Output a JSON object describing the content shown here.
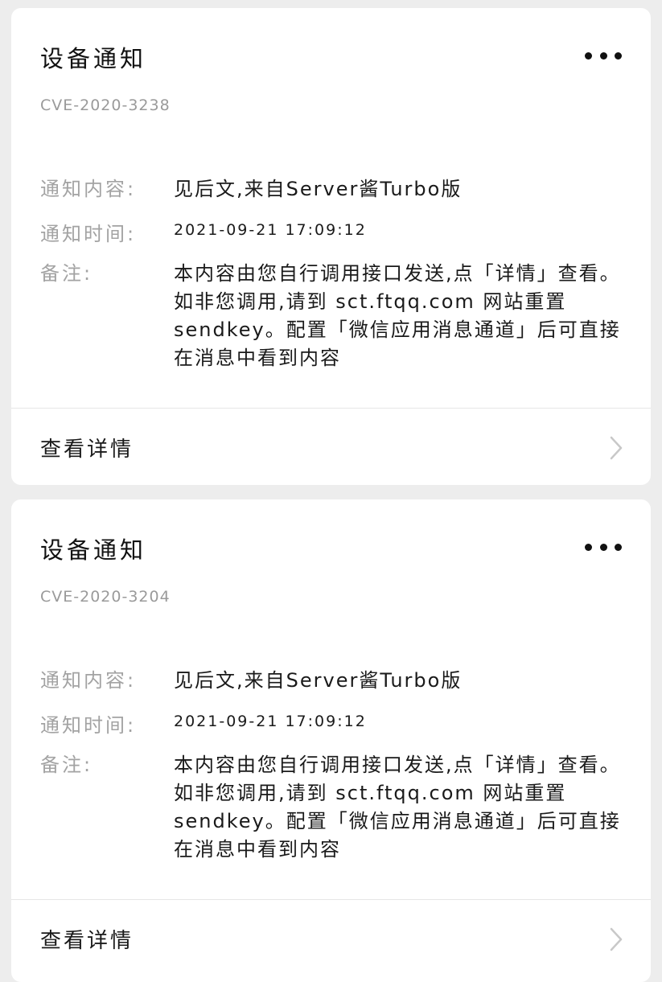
{
  "notifications": [
    {
      "title": "设备通知",
      "subtitle": "CVE-2020-3238",
      "content_label": "通知内容:",
      "content_value": "见后文,来自Server酱Turbo版",
      "time_label": "通知时间:",
      "time_value": "2021-09-21 17:09:12",
      "remark_label": "备注:",
      "remark_value": "本内容由您自行调用接口发送,点「详情」查看。如非您调用,请到 sct.ftqq.com 网站重置 sendkey。配置「微信应用消息通道」后可直接在消息中看到内容",
      "detail_label": "查看详情"
    },
    {
      "title": "设备通知",
      "subtitle": "CVE-2020-3204",
      "content_label": "通知内容:",
      "content_value": "见后文,来自Server酱Turbo版",
      "time_label": "通知时间:",
      "time_value": "2021-09-21 17:09:12",
      "remark_label": "备注:",
      "remark_value": "本内容由您自行调用接口发送,点「详情」查看。如非您调用,请到 sct.ftqq.com 网站重置 sendkey。配置「微信应用消息通道」后可直接在消息中看到内容",
      "detail_label": "查看详情"
    }
  ],
  "icons": {
    "more": "more-dots-icon",
    "chevron": "chevron-right-icon"
  },
  "colors": {
    "background": "#ededed",
    "card": "#ffffff",
    "label": "#a3a3a3",
    "text": "#1a1a1a",
    "subtitle": "#9a9a9a",
    "chevron": "#c8c8c8"
  }
}
